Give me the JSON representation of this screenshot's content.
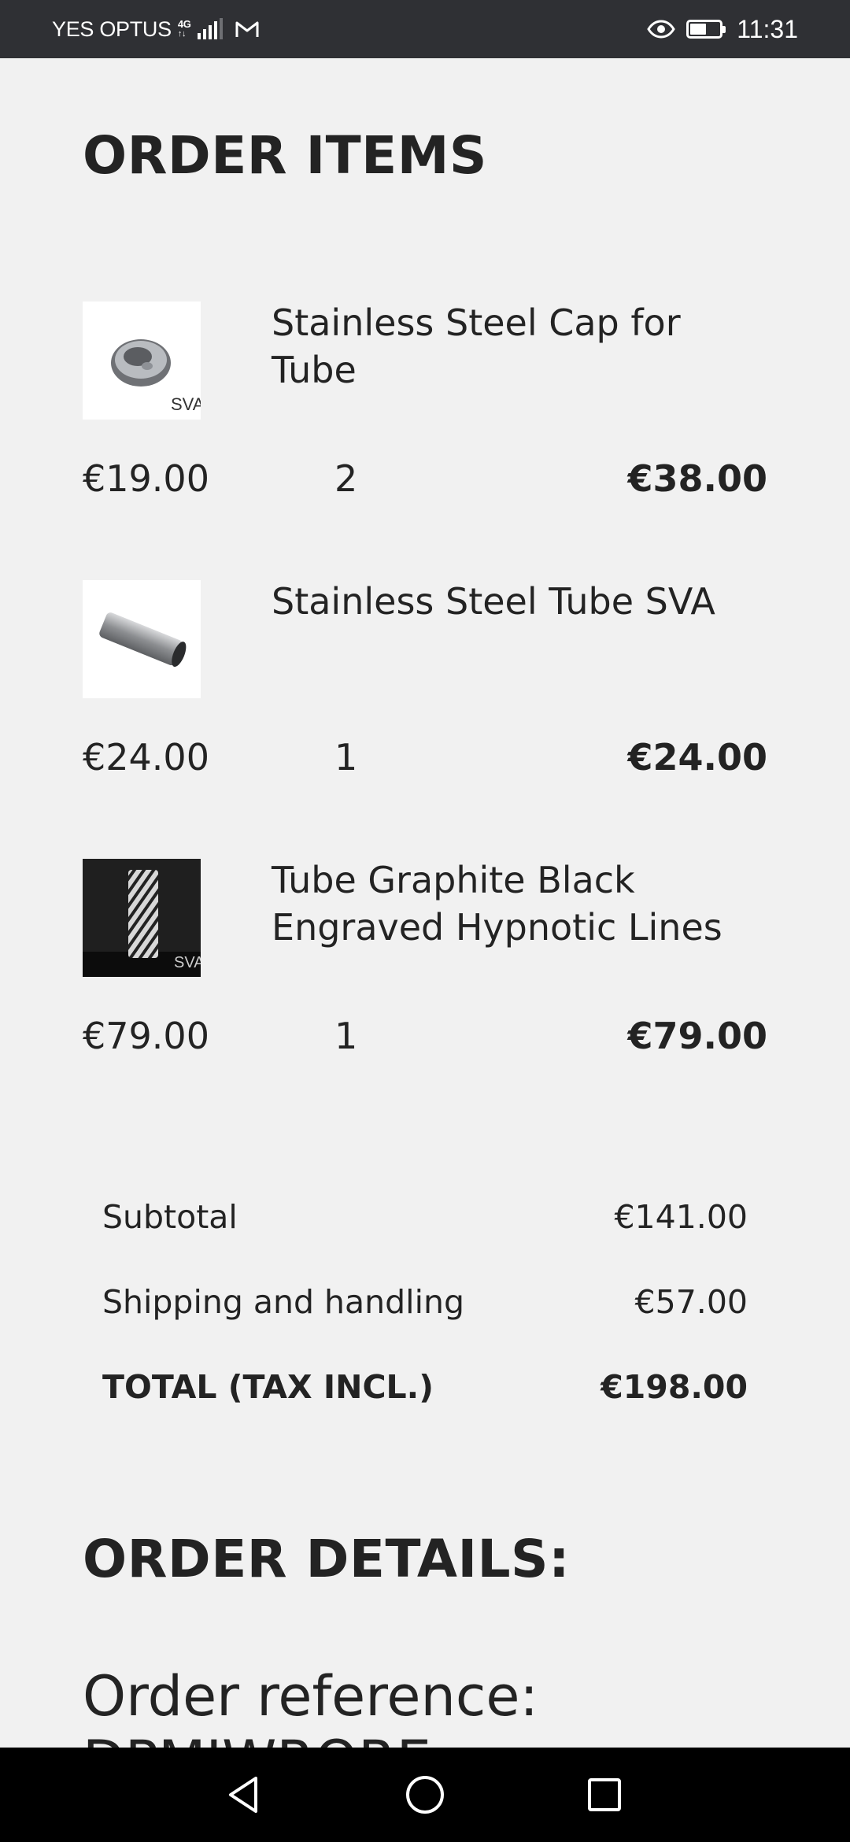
{
  "status_bar": {
    "carrier": "YES OPTUS",
    "network_type": "4G",
    "time": "11:31",
    "battery_level": 0.55
  },
  "order_items": {
    "title": "ORDER ITEMS",
    "items": [
      {
        "name": "Stainless Steel Cap for Tube",
        "unit_price": "€19.00",
        "quantity": "2",
        "total": "€38.00",
        "image_icon": "steel-cap-photo"
      },
      {
        "name": "Stainless Steel Tube SVA",
        "unit_price": "€24.00",
        "quantity": "1",
        "total": "€24.00",
        "image_icon": "steel-tube-photo"
      },
      {
        "name": "Tube Graphite Black Engraved Hypnotic Lines",
        "unit_price": "€79.00",
        "quantity": "1",
        "total": "€79.00",
        "image_icon": "engraved-tube-photo"
      }
    ]
  },
  "summary": {
    "subtotal_label": "Subtotal",
    "subtotal_value": "€141.00",
    "shipping_label": "Shipping and handling",
    "shipping_value": "€57.00",
    "total_label": "TOTAL (TAX INCL.)",
    "total_value": "€198.00"
  },
  "order_details": {
    "title": "ORDER DETAILS:",
    "reference_label": "Order reference:",
    "reference_value": "DPMIWRORE"
  }
}
